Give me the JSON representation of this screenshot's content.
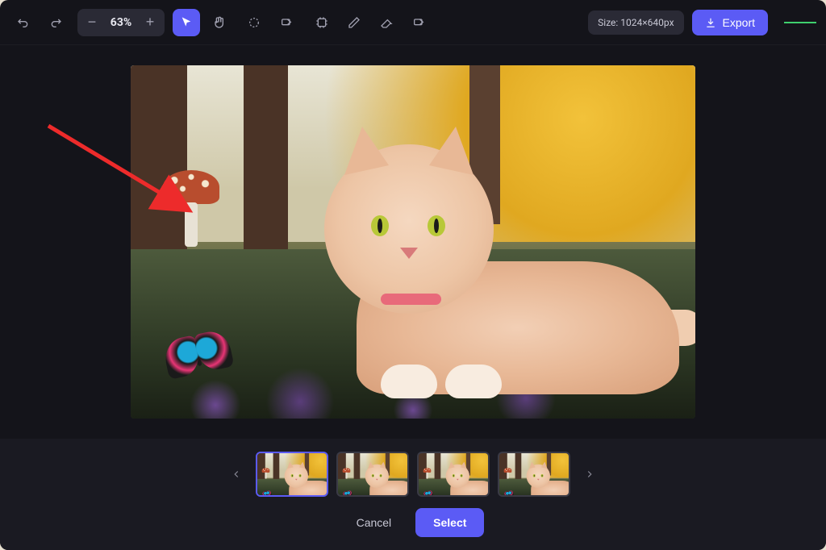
{
  "toolbar": {
    "zoom_percent": "63%",
    "size_label": "Size: 1024×640px",
    "export_label": "Export",
    "tools": {
      "undo": "undo-icon",
      "redo": "redo-icon",
      "zoom_out": "−",
      "zoom_in": "+",
      "pointer": "pointer-icon",
      "pan": "hand-icon",
      "lasso": "circle-select-icon",
      "erase_select": "erase-select-icon",
      "transform": "transform-icon",
      "pencil": "pencil-icon",
      "eraser": "eraser-icon",
      "delete": "delete-icon"
    }
  },
  "canvas": {
    "image_description": "Fluffy orange long-haired cat lying on grass in a forest with a mushroom and a colorful butterfly",
    "annotation": "red-arrow-pointing-to-mushroom"
  },
  "variants": {
    "count": 4,
    "selected_index": 0
  },
  "actions": {
    "cancel_label": "Cancel",
    "select_label": "Select"
  },
  "colors": {
    "accent": "#5b5bf5",
    "bg": "#14141a",
    "panel": "#1a1a22",
    "arrow": "#ed2b2b"
  }
}
